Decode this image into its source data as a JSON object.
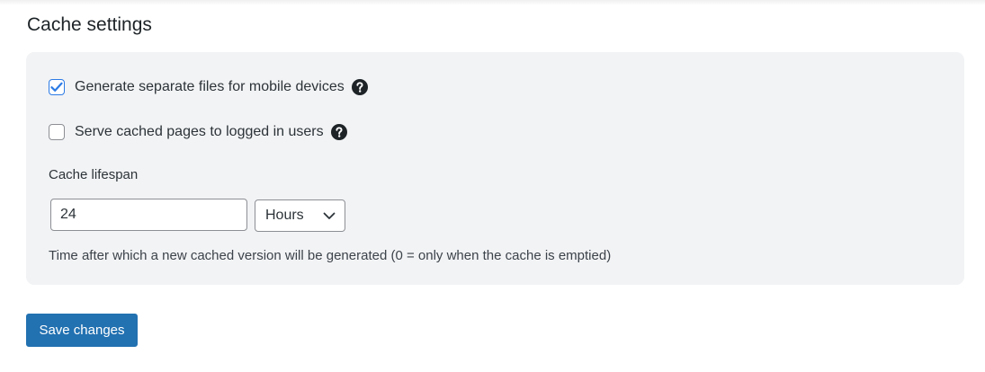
{
  "section": {
    "title": "Cache settings"
  },
  "options": {
    "mobile": {
      "label": "Generate separate files for mobile devices",
      "checked": true,
      "help_icon": "question-circle-icon"
    },
    "logged_in": {
      "label": "Serve cached pages to logged in users",
      "checked": false,
      "help_icon": "question-circle-icon"
    }
  },
  "lifespan": {
    "label": "Cache lifespan",
    "value": "24",
    "unit": "Hours",
    "help_text": "Time after which a new cached version will be generated (0 = only when the cache is emptied)"
  },
  "actions": {
    "save_label": "Save changes"
  },
  "colors": {
    "accent": "#2271b1",
    "checkbox_check": "#2c7be5",
    "panel_bg": "#f2f3f5",
    "text": "#1d2327"
  }
}
